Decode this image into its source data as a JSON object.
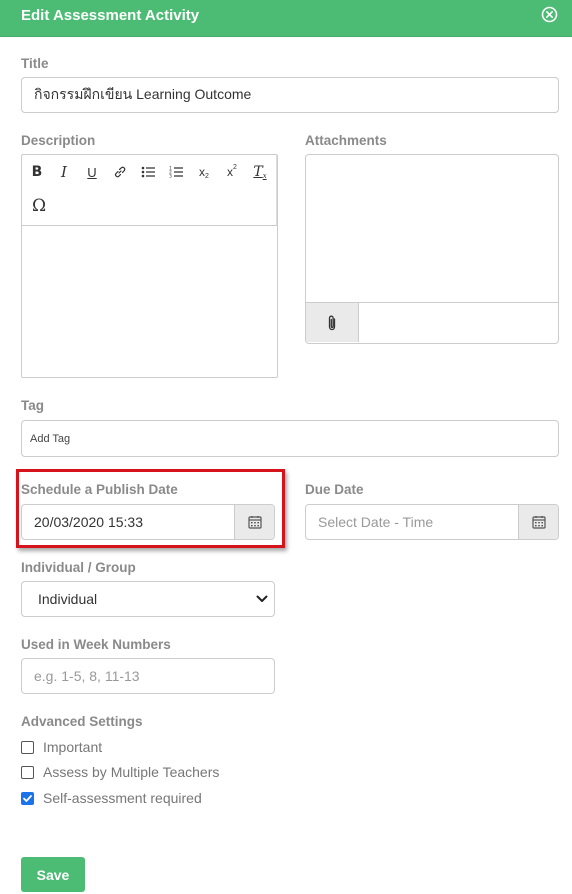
{
  "modal": {
    "title": "Edit Assessment Activity"
  },
  "form": {
    "title_label": "Title",
    "title_value": "กิจกรรมฝึกเขียน Learning Outcome",
    "description_label": "Description",
    "attachments_label": "Attachments",
    "editor_toolbar": [
      "bold-icon",
      "italic-icon",
      "underline-icon",
      "link-icon",
      "bulleted-list-icon",
      "numbered-list-icon",
      "subscript-icon",
      "superscript-icon",
      "clear-format-icon",
      "omega-icon"
    ],
    "tag_label": "Tag",
    "tag_placeholder": "Add Tag",
    "publish_label": "Schedule a Publish Date",
    "publish_value": "20/03/2020 15:33",
    "due_label": "Due Date",
    "due_placeholder": "Select Date - Time",
    "group_label": "Individual / Group",
    "group_value": "Individual",
    "week_label": "Used in Week Numbers",
    "week_placeholder": "e.g. 1-5, 8, 11-13",
    "advanced_label": "Advanced Settings",
    "checkboxes": [
      {
        "label": "Important",
        "checked": false
      },
      {
        "label": "Assess by Multiple Teachers",
        "checked": false
      },
      {
        "label": "Self-assessment required",
        "checked": true
      }
    ],
    "save_label": "Save"
  },
  "colors": {
    "header": "#4cbb74",
    "highlight": "#d6121a",
    "checkbox": "#1a73e8"
  }
}
